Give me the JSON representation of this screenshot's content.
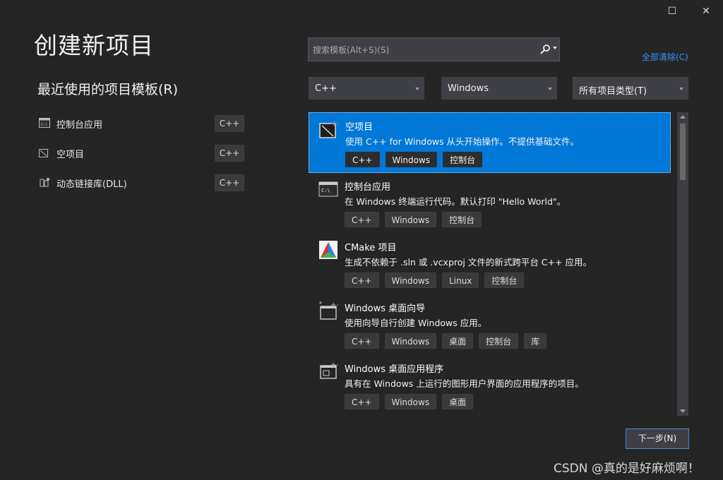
{
  "window": {
    "maximize_label": "☐",
    "close_label": "✕"
  },
  "page_title": "创建新项目",
  "recent": {
    "title": "最近使用的项目模板(R)",
    "items": [
      {
        "label": "控制台应用",
        "tag": "C++",
        "icon": "console-app-icon"
      },
      {
        "label": "空项目",
        "tag": "C++",
        "icon": "empty-project-icon"
      },
      {
        "label": "动态链接库(DLL)",
        "tag": "C++",
        "icon": "dll-icon"
      }
    ]
  },
  "search": {
    "placeholder": "搜索模板(Alt+S)(S)"
  },
  "clear_all": "全部清除(C)",
  "filters": {
    "language": "C++",
    "platform": "Windows",
    "project_type": "所有项目类型(T)"
  },
  "templates": [
    {
      "name": "空项目",
      "description": "使用 C++ for Windows 从头开始操作。不提供基础文件。",
      "tags": [
        "C++",
        "Windows",
        "控制台"
      ],
      "icon": "empty-project-icon",
      "selected": true
    },
    {
      "name": "控制台应用",
      "description": "在 Windows 终端运行代码。默认打印 \"Hello World\"。",
      "tags": [
        "C++",
        "Windows",
        "控制台"
      ],
      "icon": "console-app-icon"
    },
    {
      "name": "CMake 项目",
      "description": "生成不依赖于 .sln 或 .vcxproj 文件的新式跨平台 C++ 应用。",
      "tags": [
        "C++",
        "Windows",
        "Linux",
        "控制台"
      ],
      "icon": "cmake-icon"
    },
    {
      "name": "Windows 桌面向导",
      "description": "使用向导自行创建 Windows 应用。",
      "tags": [
        "C++",
        "Windows",
        "桌面",
        "控制台",
        "库"
      ],
      "icon": "desktop-wizard-icon"
    },
    {
      "name": "Windows 桌面应用程序",
      "description": "具有在 Windows 上运行的图形用户界面的应用程序的项目。",
      "tags": [
        "C++",
        "Windows",
        "桌面"
      ],
      "icon": "desktop-app-icon"
    }
  ],
  "next_button": "下一步(N)",
  "watermark": "CSDN @真的是好麻烦啊！",
  "colors": {
    "accent": "#0078d7",
    "link": "#3794ff",
    "background": "#252526"
  }
}
